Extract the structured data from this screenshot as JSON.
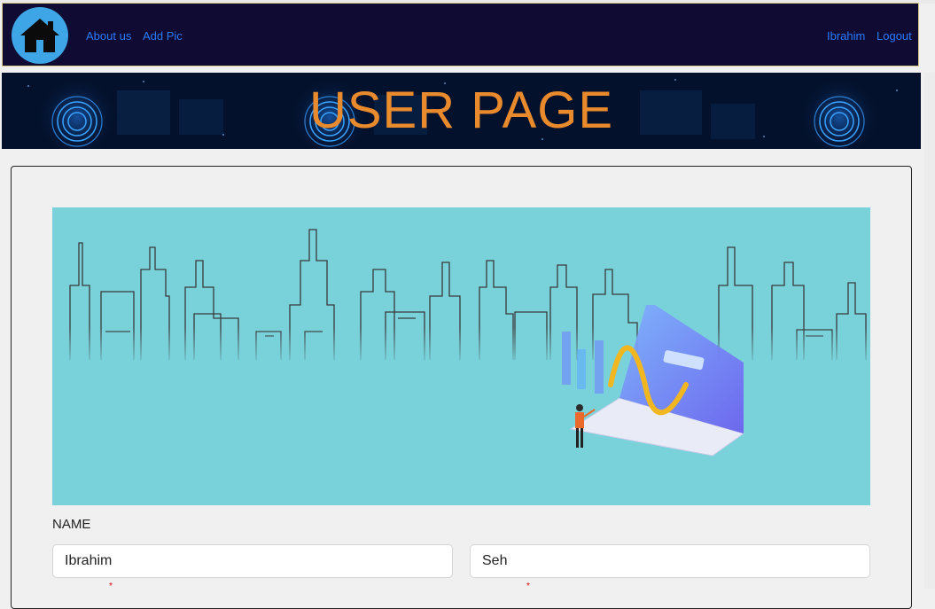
{
  "nav": {
    "home_icon": "house-icon",
    "about_label": "About us",
    "addpic_label": "Add Pic",
    "user_label": "Ibrahim",
    "logout_label": "Logout"
  },
  "banner": {
    "title": "USER PAGE"
  },
  "hero": {
    "image": "city-skyline-laptop-illustration"
  },
  "form": {
    "name_label": "NAME",
    "first_name_value": "Ibrahim",
    "last_name_value": "Seh"
  },
  "colors": {
    "nav_bg": "#100b33",
    "link": "#2a7bff",
    "banner_title": "#e98a2d",
    "hero_bg": "#79d2da"
  }
}
